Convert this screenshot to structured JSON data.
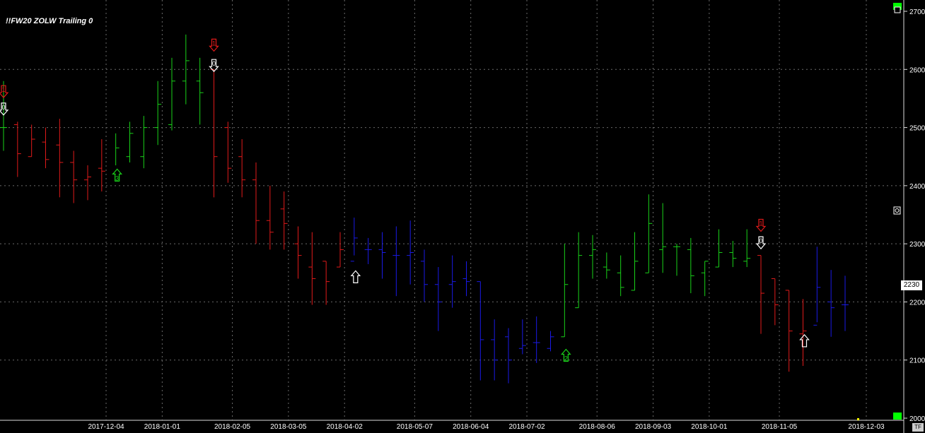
{
  "window": {
    "title": "!!FW20 ZOLW Trailing 0",
    "last_price": "2230",
    "tf_label": "TF"
  },
  "colors": {
    "background": "#000000",
    "grid": "#6a6a6a",
    "up": "#19d219",
    "down": "#e01a1a",
    "neutral": "#1a1ae6",
    "signal_white": "#ffffff"
  },
  "chart_data": {
    "type": "bar",
    "subtype": "ohlc",
    "ylim": [
      2000,
      2700
    ],
    "yticks": [
      2000,
      2100,
      2200,
      2300,
      2400,
      2500,
      2600,
      2700
    ],
    "xticks": [
      "2017-12-04",
      "2018-01-01",
      "2018-02-05",
      "2018-03-05",
      "2018-04-02",
      "2018-05-07",
      "2018-06-04",
      "2018-07-02",
      "2018-08-06",
      "2018-09-03",
      "2018-10-01",
      "2018-11-05",
      "2018-12-03"
    ],
    "grid": true,
    "bars": [
      {
        "c": "up",
        "o": 2500,
        "h": 2580,
        "l": 2460,
        "cl": 2500
      },
      {
        "c": "down",
        "o": 2505,
        "h": 2510,
        "l": 2415,
        "cl": 2455
      },
      {
        "c": "down",
        "o": 2450,
        "h": 2505,
        "l": 2450,
        "cl": 2480
      },
      {
        "c": "down",
        "o": 2475,
        "h": 2500,
        "l": 2430,
        "cl": 2445
      },
      {
        "c": "down",
        "o": 2470,
        "h": 2515,
        "l": 2380,
        "cl": 2440
      },
      {
        "c": "down",
        "o": 2440,
        "h": 2460,
        "l": 2370,
        "cl": 2410
      },
      {
        "c": "down",
        "o": 2410,
        "h": 2435,
        "l": 2375,
        "cl": 2415
      },
      {
        "c": "down",
        "o": 2430,
        "h": 2480,
        "l": 2390,
        "cl": 2425
      },
      {
        "c": "up",
        "o": 2420,
        "h": 2490,
        "l": 2435,
        "cl": 2465
      },
      {
        "c": "up",
        "o": 2450,
        "h": 2510,
        "l": 2440,
        "cl": 2490
      },
      {
        "c": "up",
        "o": 2450,
        "h": 2520,
        "l": 2430,
        "cl": 2500
      },
      {
        "c": "up",
        "o": 2500,
        "h": 2580,
        "l": 2470,
        "cl": 2540
      },
      {
        "c": "up",
        "o": 2505,
        "h": 2620,
        "l": 2495,
        "cl": 2580
      },
      {
        "c": "up",
        "o": 2580,
        "h": 2660,
        "l": 2540,
        "cl": 2615
      },
      {
        "c": "up",
        "o": 2580,
        "h": 2620,
        "l": 2505,
        "cl": 2560
      },
      {
        "c": "down",
        "o": 2600,
        "h": 2600,
        "l": 2380,
        "cl": 2450
      },
      {
        "c": "down",
        "o": 2500,
        "h": 2510,
        "l": 2405,
        "cl": 2430
      },
      {
        "c": "down",
        "o": 2450,
        "h": 2480,
        "l": 2380,
        "cl": 2410
      },
      {
        "c": "down",
        "o": 2410,
        "h": 2440,
        "l": 2300,
        "cl": 2340
      },
      {
        "c": "down",
        "o": 2340,
        "h": 2400,
        "l": 2290,
        "cl": 2320
      },
      {
        "c": "down",
        "o": 2360,
        "h": 2390,
        "l": 2290,
        "cl": 2335
      },
      {
        "c": "down",
        "o": 2300,
        "h": 2330,
        "l": 2240,
        "cl": 2280
      },
      {
        "c": "down",
        "o": 2260,
        "h": 2320,
        "l": 2195,
        "cl": 2240
      },
      {
        "c": "down",
        "o": 2270,
        "h": 2270,
        "l": 2195,
        "cl": 2235
      },
      {
        "c": "down",
        "o": 2260,
        "h": 2320,
        "l": 2260,
        "cl": 2290
      },
      {
        "c": "neutral",
        "o": 2270,
        "h": 2345,
        "l": 2280,
        "cl": 2310
      },
      {
        "c": "neutral",
        "o": 2290,
        "h": 2310,
        "l": 2265,
        "cl": 2290
      },
      {
        "c": "neutral",
        "o": 2290,
        "h": 2320,
        "l": 2240,
        "cl": 2285
      },
      {
        "c": "neutral",
        "o": 2280,
        "h": 2330,
        "l": 2210,
        "cl": 2280
      },
      {
        "c": "neutral",
        "o": 2280,
        "h": 2340,
        "l": 2230,
        "cl": 2285
      },
      {
        "c": "neutral",
        "o": 2270,
        "h": 2290,
        "l": 2200,
        "cl": 2230
      },
      {
        "c": "neutral",
        "o": 2230,
        "h": 2260,
        "l": 2150,
        "cl": 2200
      },
      {
        "c": "neutral",
        "o": 2230,
        "h": 2280,
        "l": 2190,
        "cl": 2235
      },
      {
        "c": "neutral",
        "o": 2240,
        "h": 2270,
        "l": 2210,
        "cl": 2235
      },
      {
        "c": "neutral",
        "o": 2235,
        "h": 2235,
        "l": 2065,
        "cl": 2135
      },
      {
        "c": "neutral",
        "o": 2135,
        "h": 2170,
        "l": 2065,
        "cl": 2100
      },
      {
        "c": "neutral",
        "o": 2140,
        "h": 2155,
        "l": 2060,
        "cl": 2100
      },
      {
        "c": "neutral",
        "o": 2120,
        "h": 2170,
        "l": 2110,
        "cl": 2125
      },
      {
        "c": "neutral",
        "o": 2130,
        "h": 2175,
        "l": 2095,
        "cl": 2130
      },
      {
        "c": "neutral",
        "o": 2120,
        "h": 2150,
        "l": 2115,
        "cl": 2140
      },
      {
        "c": "up",
        "o": 2140,
        "h": 2300,
        "l": 2140,
        "cl": 2230
      },
      {
        "c": "up",
        "o": 2190,
        "h": 2320,
        "l": 2190,
        "cl": 2280
      },
      {
        "c": "up",
        "o": 2280,
        "h": 2315,
        "l": 2240,
        "cl": 2290
      },
      {
        "c": "up",
        "o": 2260,
        "h": 2285,
        "l": 2240,
        "cl": 2255
      },
      {
        "c": "up",
        "o": 2250,
        "h": 2280,
        "l": 2210,
        "cl": 2225
      },
      {
        "c": "up",
        "o": 2220,
        "h": 2320,
        "l": 2220,
        "cl": 2270
      },
      {
        "c": "up",
        "o": 2250,
        "h": 2385,
        "l": 2250,
        "cl": 2335
      },
      {
        "c": "up",
        "o": 2290,
        "h": 2370,
        "l": 2250,
        "cl": 2295
      },
      {
        "c": "up",
        "o": 2295,
        "h": 2300,
        "l": 2245,
        "cl": 2295
      },
      {
        "c": "up",
        "o": 2290,
        "h": 2310,
        "l": 2215,
        "cl": 2245
      },
      {
        "c": "up",
        "o": 2250,
        "h": 2270,
        "l": 2210,
        "cl": 2270
      },
      {
        "c": "up",
        "o": 2260,
        "h": 2325,
        "l": 2260,
        "cl": 2285
      },
      {
        "c": "up",
        "o": 2285,
        "h": 2305,
        "l": 2260,
        "cl": 2275
      },
      {
        "c": "up",
        "o": 2270,
        "h": 2325,
        "l": 2260,
        "cl": 2275
      },
      {
        "c": "down",
        "o": 2280,
        "h": 2280,
        "l": 2145,
        "cl": 2215
      },
      {
        "c": "down",
        "o": 2240,
        "h": 2240,
        "l": 2160,
        "cl": 2195
      },
      {
        "c": "down",
        "o": 2220,
        "h": 2220,
        "l": 2080,
        "cl": 2150
      },
      {
        "c": "down",
        "o": 2145,
        "h": 2205,
        "l": 2090,
        "cl": 2150
      },
      {
        "c": "neutral",
        "o": 2160,
        "h": 2295,
        "l": 2165,
        "cl": 2225
      },
      {
        "c": "neutral",
        "o": 2200,
        "h": 2255,
        "l": 2140,
        "cl": 2190
      },
      {
        "c": "neutral",
        "o": 2195,
        "h": 2245,
        "l": 2150,
        "cl": 2195
      }
    ],
    "signals": [
      {
        "dir": "down",
        "bar": 0,
        "price": 2560,
        "label": "1",
        "color": "down"
      },
      {
        "dir": "down",
        "bar": 0,
        "price": 2530,
        "label": "0",
        "color": "signal_white"
      },
      {
        "dir": "up",
        "bar": 8,
        "price": 2420,
        "label": "3",
        "color": "up"
      },
      {
        "dir": "down",
        "bar": 15,
        "price": 2640,
        "label": "1",
        "color": "down"
      },
      {
        "dir": "down",
        "bar": 15,
        "price": 2605,
        "label": "0",
        "color": "signal_white"
      },
      {
        "dir": "up",
        "bar": 25,
        "price": 2245,
        "label": "",
        "color": "signal_white"
      },
      {
        "dir": "up",
        "bar": 40,
        "price": 2110,
        "label": "2",
        "color": "up"
      },
      {
        "dir": "down",
        "bar": 54,
        "price": 2330,
        "label": "1",
        "color": "down"
      },
      {
        "dir": "down",
        "bar": 54,
        "price": 2300,
        "label": "0",
        "color": "signal_white"
      },
      {
        "dir": "up",
        "bar": 57,
        "price": 2135,
        "label": "",
        "color": "signal_white"
      }
    ]
  }
}
